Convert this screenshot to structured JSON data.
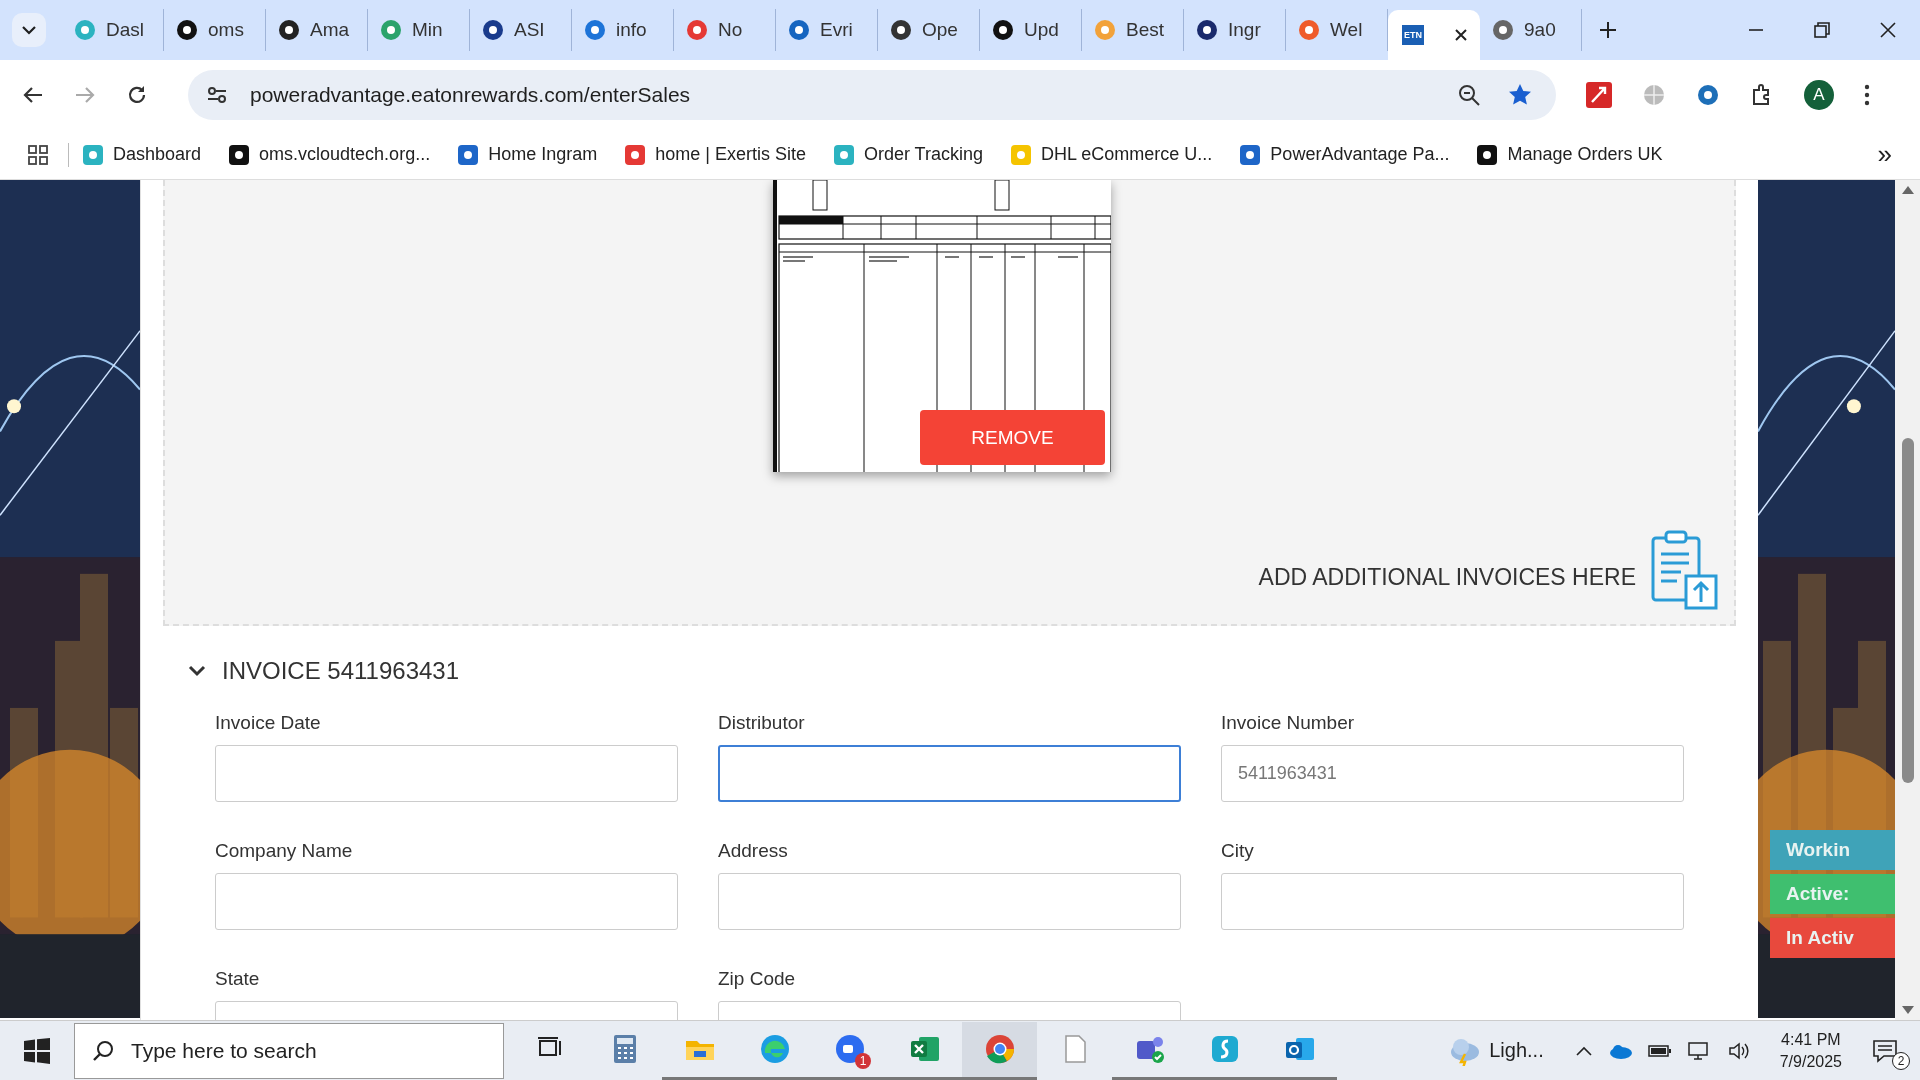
{
  "browser": {
    "tabs": [
      {
        "label": "Dasl",
        "selected": false
      },
      {
        "label": "oms",
        "selected": false
      },
      {
        "label": "Ama",
        "selected": false
      },
      {
        "label": "Min",
        "selected": false
      },
      {
        "label": "ASI",
        "selected": false
      },
      {
        "label": "info",
        "selected": false
      },
      {
        "label": "No",
        "selected": false
      },
      {
        "label": "Evri",
        "selected": false
      },
      {
        "label": "Ope",
        "selected": false
      },
      {
        "label": "Upd",
        "selected": false
      },
      {
        "label": "Best",
        "selected": false
      },
      {
        "label": "Ingr",
        "selected": false
      },
      {
        "label": "Wel",
        "selected": false
      },
      {
        "icon_text": "ETN",
        "selected": true
      },
      {
        "label": "9a0",
        "selected": false
      }
    ],
    "address": "poweradvantage.eatonrewards.com/enterSales",
    "profile": "A",
    "bookmarks": [
      "Dashboard",
      "oms.vcloudtech.org...",
      "Home Ingram",
      "home | Exertis Site",
      "Order Tracking",
      "DHL eCommerce U...",
      "PowerAdvantage Pa...",
      "Manage Orders UK"
    ],
    "bookmarks_more": "»"
  },
  "side_widget": [
    {
      "label": "Workin",
      "color": "#3fa3b8"
    },
    {
      "label": "Active:",
      "color": "#3fbf6f"
    },
    {
      "label": "In Activ",
      "color": "#e8493d"
    }
  ],
  "upload": {
    "remove_button": "REMOVE",
    "add_invoices": "ADD ADDITIONAL INVOICES HERE"
  },
  "invoice": {
    "title": "INVOICE 5411963431",
    "expanded": true,
    "fields": [
      {
        "label": "Invoice Date",
        "focused": false
      },
      {
        "label": "Distributor",
        "focused": true
      },
      {
        "label": "Invoice Number",
        "value": "5411963431",
        "focused": false
      },
      {
        "label": "Company Name",
        "focused": false
      },
      {
        "label": "Address",
        "focused": false
      },
      {
        "label": "City",
        "focused": false
      },
      {
        "label": "State",
        "focused": false
      },
      {
        "label": "Zip Code",
        "focused": false
      }
    ]
  },
  "taskbar": {
    "search_placeholder": "Type here to search",
    "apps": [
      {
        "kind": "taskview",
        "running": false,
        "selected": false
      },
      {
        "kind": "calculator",
        "running": false,
        "selected": false
      },
      {
        "kind": "folder",
        "running": true,
        "selected": false
      },
      {
        "kind": "edge",
        "running": true,
        "selected": false
      },
      {
        "kind": "zoom",
        "running": true,
        "selected": false,
        "badge": "1"
      },
      {
        "kind": "excel",
        "running": true,
        "selected": false
      },
      {
        "kind": "chrome",
        "running": true,
        "selected": true
      },
      {
        "kind": "notepad",
        "running": false,
        "selected": false
      },
      {
        "kind": "teams",
        "running": true,
        "selected": false
      },
      {
        "kind": "sapp",
        "running": true,
        "selected": false
      },
      {
        "kind": "outlook",
        "running": true,
        "selected": false
      }
    ],
    "weather": "Ligh...",
    "time": "4:41 PM",
    "date": "7/9/2025",
    "notifications": "2"
  }
}
